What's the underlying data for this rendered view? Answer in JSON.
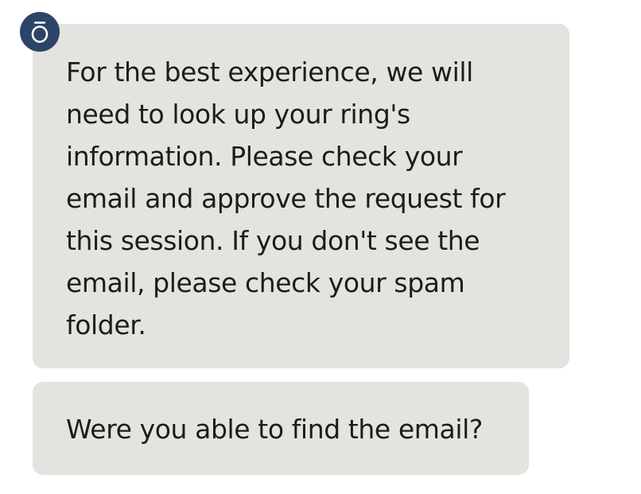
{
  "agent": {
    "avatar_icon": "ring-logo-icon",
    "avatar_color": "#2c4468"
  },
  "colors": {
    "bubble_background": "#e4e3df",
    "text": "#1c1c1c"
  },
  "messages": [
    {
      "sender": "agent",
      "lines": [
        "For the best experience, we will",
        "need to look up your ring's",
        "information. Please check your",
        "email and approve the request for",
        "this session. If you don't see the",
        "email, please check your spam",
        "folder."
      ]
    },
    {
      "sender": "agent",
      "lines": [
        "Were you able to find the email?"
      ]
    }
  ]
}
